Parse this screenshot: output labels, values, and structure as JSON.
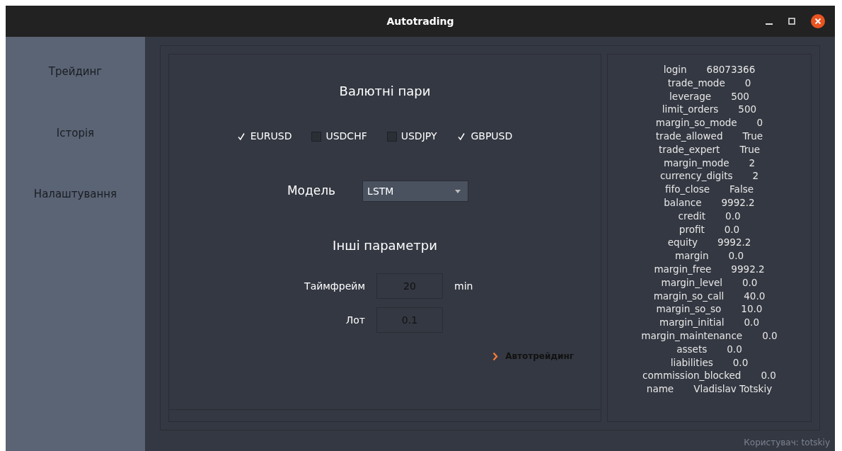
{
  "window": {
    "title": "Autotrading"
  },
  "sidebar": {
    "items": [
      {
        "label": "Трейдинг"
      },
      {
        "label": "Історія"
      },
      {
        "label": "Налаштування"
      }
    ]
  },
  "currency_pairs": {
    "title": "Валютні пари",
    "items": [
      {
        "label": "EURUSD",
        "checked": true
      },
      {
        "label": "USDCHF",
        "checked": false
      },
      {
        "label": "USDJPY",
        "checked": false
      },
      {
        "label": "GBPUSD",
        "checked": true
      }
    ]
  },
  "model": {
    "label": "Модель",
    "value": "LSTM"
  },
  "other_params": {
    "title": "Інші параметри",
    "timeframe": {
      "label": "Таймфрейм",
      "value": "20",
      "unit": "min"
    },
    "lot": {
      "label": "Лот",
      "value": "0.1"
    }
  },
  "autotrading_button": {
    "label": "Автотрейдинг"
  },
  "account_info": [
    {
      "key": "login",
      "value": "68073366"
    },
    {
      "key": "trade_mode",
      "value": "0"
    },
    {
      "key": "leverage",
      "value": "500"
    },
    {
      "key": "limit_orders",
      "value": "500"
    },
    {
      "key": "margin_so_mode",
      "value": "0"
    },
    {
      "key": "trade_allowed",
      "value": "True"
    },
    {
      "key": "trade_expert",
      "value": "True"
    },
    {
      "key": "margin_mode",
      "value": "2"
    },
    {
      "key": "currency_digits",
      "value": "2"
    },
    {
      "key": "fifo_close",
      "value": "False"
    },
    {
      "key": "balance",
      "value": "9992.2"
    },
    {
      "key": "credit",
      "value": "0.0"
    },
    {
      "key": "profit",
      "value": "0.0"
    },
    {
      "key": "equity",
      "value": "9992.2"
    },
    {
      "key": "margin",
      "value": "0.0"
    },
    {
      "key": "margin_free",
      "value": "9992.2"
    },
    {
      "key": "margin_level",
      "value": "0.0"
    },
    {
      "key": "margin_so_call",
      "value": "40.0"
    },
    {
      "key": "margin_so_so",
      "value": "10.0"
    },
    {
      "key": "margin_initial",
      "value": "0.0"
    },
    {
      "key": "margin_maintenance",
      "value": "0.0"
    },
    {
      "key": "assets",
      "value": "0.0"
    },
    {
      "key": "liabilities",
      "value": "0.0"
    },
    {
      "key": "commission_blocked",
      "value": "0.0"
    },
    {
      "key": "name",
      "value": "Vladislav Totskiy"
    }
  ],
  "status_bar": {
    "user": "Користувач: totskiy"
  }
}
